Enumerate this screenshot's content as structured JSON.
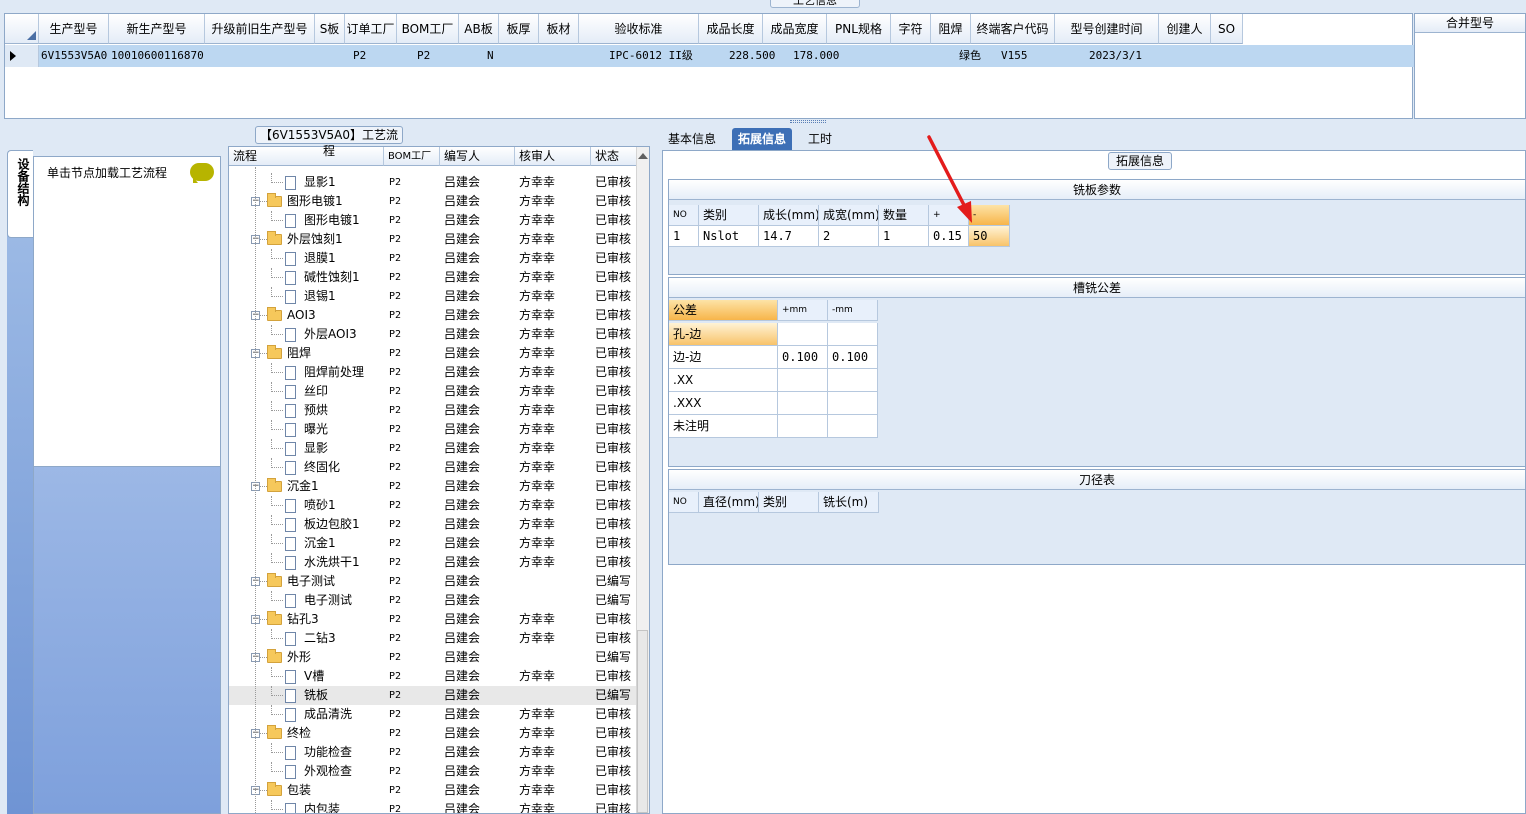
{
  "top": {
    "caption": "工艺信息",
    "columns": [
      "生产型号",
      "新生产型号",
      "升级前旧生产型号",
      "S板",
      "订单工厂",
      "BOM工厂",
      "AB板",
      "板厚",
      "板材",
      "验收标准",
      "成品长度",
      "成品宽度",
      "PNL规格",
      "字符",
      "阻焊",
      "终端客户代码",
      "型号创建时间",
      "创建人",
      "SO"
    ],
    "row": {
      "prod_model": "6V1553V5A0",
      "new_model": "10010600116870",
      "order_factory": "P2",
      "bom_factory": "P2",
      "ab": "N",
      "standard": "IPC-6012 II级",
      "length": "228.500",
      "width": "178.000",
      "solder": "绿色",
      "customer": "V155",
      "created": "2023/3/1"
    },
    "merge_header": "合并型号"
  },
  "left": {
    "vertical_tab": "设备结构",
    "nav_hint": "单击节点加载工艺流程",
    "tree_caption": "【6V1553V5A0】工艺流程",
    "tree_headers": [
      "流程",
      "BOM工厂",
      "编写人",
      "核审人",
      "状态"
    ],
    "rows": [
      {
        "label": "显影1",
        "lvl": 2,
        "bom": "P2",
        "writer": "吕建会",
        "reviewer": "方幸幸",
        "status": "已审核"
      },
      {
        "label": "图形电镀1",
        "lvl": 1,
        "bom": "P2",
        "writer": "吕建会",
        "reviewer": "方幸幸",
        "status": "已审核"
      },
      {
        "label": "图形电镀1",
        "lvl": 2,
        "bom": "P2",
        "writer": "吕建会",
        "reviewer": "方幸幸",
        "status": "已审核"
      },
      {
        "label": "外层蚀刻1",
        "lvl": 1,
        "bom": "P2",
        "writer": "吕建会",
        "reviewer": "方幸幸",
        "status": "已审核"
      },
      {
        "label": "退膜1",
        "lvl": 2,
        "bom": "P2",
        "writer": "吕建会",
        "reviewer": "方幸幸",
        "status": "已审核"
      },
      {
        "label": "碱性蚀刻1",
        "lvl": 2,
        "bom": "P2",
        "writer": "吕建会",
        "reviewer": "方幸幸",
        "status": "已审核"
      },
      {
        "label": "退锡1",
        "lvl": 2,
        "bom": "P2",
        "writer": "吕建会",
        "reviewer": "方幸幸",
        "status": "已审核"
      },
      {
        "label": "AOI3",
        "lvl": 1,
        "bom": "P2",
        "writer": "吕建会",
        "reviewer": "方幸幸",
        "status": "已审核"
      },
      {
        "label": "外层AOI3",
        "lvl": 2,
        "bom": "P2",
        "writer": "吕建会",
        "reviewer": "方幸幸",
        "status": "已审核"
      },
      {
        "label": "阻焊",
        "lvl": 1,
        "bom": "P2",
        "writer": "吕建会",
        "reviewer": "方幸幸",
        "status": "已审核"
      },
      {
        "label": "阻焊前处理",
        "lvl": 2,
        "bom": "P2",
        "writer": "吕建会",
        "reviewer": "方幸幸",
        "status": "已审核"
      },
      {
        "label": "丝印",
        "lvl": 2,
        "bom": "P2",
        "writer": "吕建会",
        "reviewer": "方幸幸",
        "status": "已审核"
      },
      {
        "label": "预烘",
        "lvl": 2,
        "bom": "P2",
        "writer": "吕建会",
        "reviewer": "方幸幸",
        "status": "已审核"
      },
      {
        "label": "曝光",
        "lvl": 2,
        "bom": "P2",
        "writer": "吕建会",
        "reviewer": "方幸幸",
        "status": "已审核"
      },
      {
        "label": "显影",
        "lvl": 2,
        "bom": "P2",
        "writer": "吕建会",
        "reviewer": "方幸幸",
        "status": "已审核"
      },
      {
        "label": "终固化",
        "lvl": 2,
        "bom": "P2",
        "writer": "吕建会",
        "reviewer": "方幸幸",
        "status": "已审核"
      },
      {
        "label": "沉金1",
        "lvl": 1,
        "bom": "P2",
        "writer": "吕建会",
        "reviewer": "方幸幸",
        "status": "已审核"
      },
      {
        "label": "喷砂1",
        "lvl": 2,
        "bom": "P2",
        "writer": "吕建会",
        "reviewer": "方幸幸",
        "status": "已审核"
      },
      {
        "label": "板边包胶1",
        "lvl": 2,
        "bom": "P2",
        "writer": "吕建会",
        "reviewer": "方幸幸",
        "status": "已审核"
      },
      {
        "label": "沉金1",
        "lvl": 2,
        "bom": "P2",
        "writer": "吕建会",
        "reviewer": "方幸幸",
        "status": "已审核"
      },
      {
        "label": "水洗烘干1",
        "lvl": 2,
        "bom": "P2",
        "writer": "吕建会",
        "reviewer": "方幸幸",
        "status": "已审核"
      },
      {
        "label": "电子测试",
        "lvl": 1,
        "bom": "P2",
        "writer": "吕建会",
        "reviewer": "",
        "status": "已编写"
      },
      {
        "label": "电子测试",
        "lvl": 2,
        "bom": "P2",
        "writer": "吕建会",
        "reviewer": "",
        "status": "已编写"
      },
      {
        "label": "钻孔3",
        "lvl": 1,
        "bom": "P2",
        "writer": "吕建会",
        "reviewer": "方幸幸",
        "status": "已审核"
      },
      {
        "label": "二钻3",
        "lvl": 2,
        "bom": "P2",
        "writer": "吕建会",
        "reviewer": "方幸幸",
        "status": "已审核"
      },
      {
        "label": "外形",
        "lvl": 1,
        "bom": "P2",
        "writer": "吕建会",
        "reviewer": "",
        "status": "已编写"
      },
      {
        "label": "V槽",
        "lvl": 2,
        "bom": "P2",
        "writer": "吕建会",
        "reviewer": "方幸幸",
        "status": "已审核"
      },
      {
        "label": "铣板",
        "lvl": 2,
        "bom": "P2",
        "writer": "吕建会",
        "reviewer": "",
        "status": "已编写",
        "selected": true
      },
      {
        "label": "成品清洗",
        "lvl": 2,
        "bom": "P2",
        "writer": "吕建会",
        "reviewer": "方幸幸",
        "status": "已审核"
      },
      {
        "label": "终检",
        "lvl": 1,
        "bom": "P2",
        "writer": "吕建会",
        "reviewer": "方幸幸",
        "status": "已审核"
      },
      {
        "label": "功能检查",
        "lvl": 2,
        "bom": "P2",
        "writer": "吕建会",
        "reviewer": "方幸幸",
        "status": "已审核"
      },
      {
        "label": "外观检查",
        "lvl": 2,
        "bom": "P2",
        "writer": "吕建会",
        "reviewer": "方幸幸",
        "status": "已审核"
      },
      {
        "label": "包装",
        "lvl": 1,
        "bom": "P2",
        "writer": "吕建会",
        "reviewer": "方幸幸",
        "status": "已审核"
      },
      {
        "label": "内包装",
        "lvl": 2,
        "bom": "P2",
        "writer": "吕建会",
        "reviewer": "方幸幸",
        "status": "已审核"
      }
    ]
  },
  "right": {
    "tabs": [
      "基本信息",
      "拓展信息",
      "工时"
    ],
    "caption": "拓展信息",
    "mill": {
      "title": "铣板参数",
      "headers": [
        "NO",
        "类别",
        "成长(mm)",
        "成宽(mm)",
        "数量",
        "+",
        "-"
      ],
      "row": [
        "1",
        "Nslot",
        "14.7",
        "2",
        "1",
        "0.15",
        "50"
      ]
    },
    "tol": {
      "title": "槽铣公差",
      "headers": [
        "公差",
        "+mm",
        "-mm"
      ],
      "rows": [
        [
          "孔-边",
          "",
          ""
        ],
        [
          "边-边",
          "0.100",
          "0.100"
        ],
        [
          ".XX",
          "",
          ""
        ],
        [
          ".XXX",
          "",
          ""
        ],
        [
          "未注明",
          "",
          ""
        ]
      ]
    },
    "tool": {
      "title": "刀径表",
      "headers": [
        "NO",
        "直径(mm)",
        "类别",
        "铣长(m)"
      ]
    }
  }
}
